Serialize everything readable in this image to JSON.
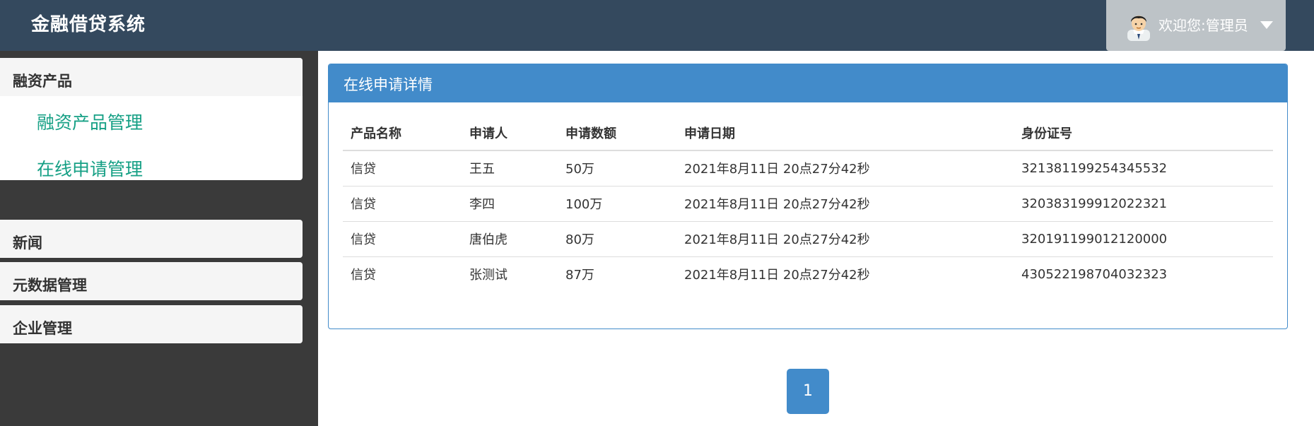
{
  "header": {
    "brand": "金融借贷系统",
    "welcome": "欢迎您:管理员"
  },
  "sidebar": {
    "groups": [
      {
        "label": "融资产品",
        "items": [
          "融资产品管理",
          "在线申请管理"
        ]
      },
      {
        "label": "新闻"
      },
      {
        "label": "元数据管理"
      },
      {
        "label": "企业管理"
      }
    ]
  },
  "main": {
    "panel_title": "在线申请详情",
    "columns": [
      "产品名称",
      "申请人",
      "申请数额",
      "申请日期",
      "身份证号"
    ],
    "rows": [
      [
        "信贷",
        "王五",
        "50万",
        "2021年8月11日 20点27分42秒",
        "321381199254345532"
      ],
      [
        "信贷",
        "李四",
        "100万",
        "2021年8月11日 20点27分42秒",
        "320383199912022321"
      ],
      [
        "信贷",
        "唐伯虎",
        "80万",
        "2021年8月11日 20点27分42秒",
        "320191199012120000"
      ],
      [
        "信贷",
        "张测试",
        "87万",
        "2021年8月11日 20点27分42秒",
        "430522198704032323"
      ]
    ],
    "pagination": {
      "current": "1"
    }
  },
  "colors": {
    "header_bg": "#34495e",
    "panel_primary": "#428bca",
    "link_green": "#16a085",
    "user_box": "#bdc3c7"
  },
  "icons": {
    "avatar": "user-avatar-icon",
    "caret": "caret-down-icon"
  }
}
